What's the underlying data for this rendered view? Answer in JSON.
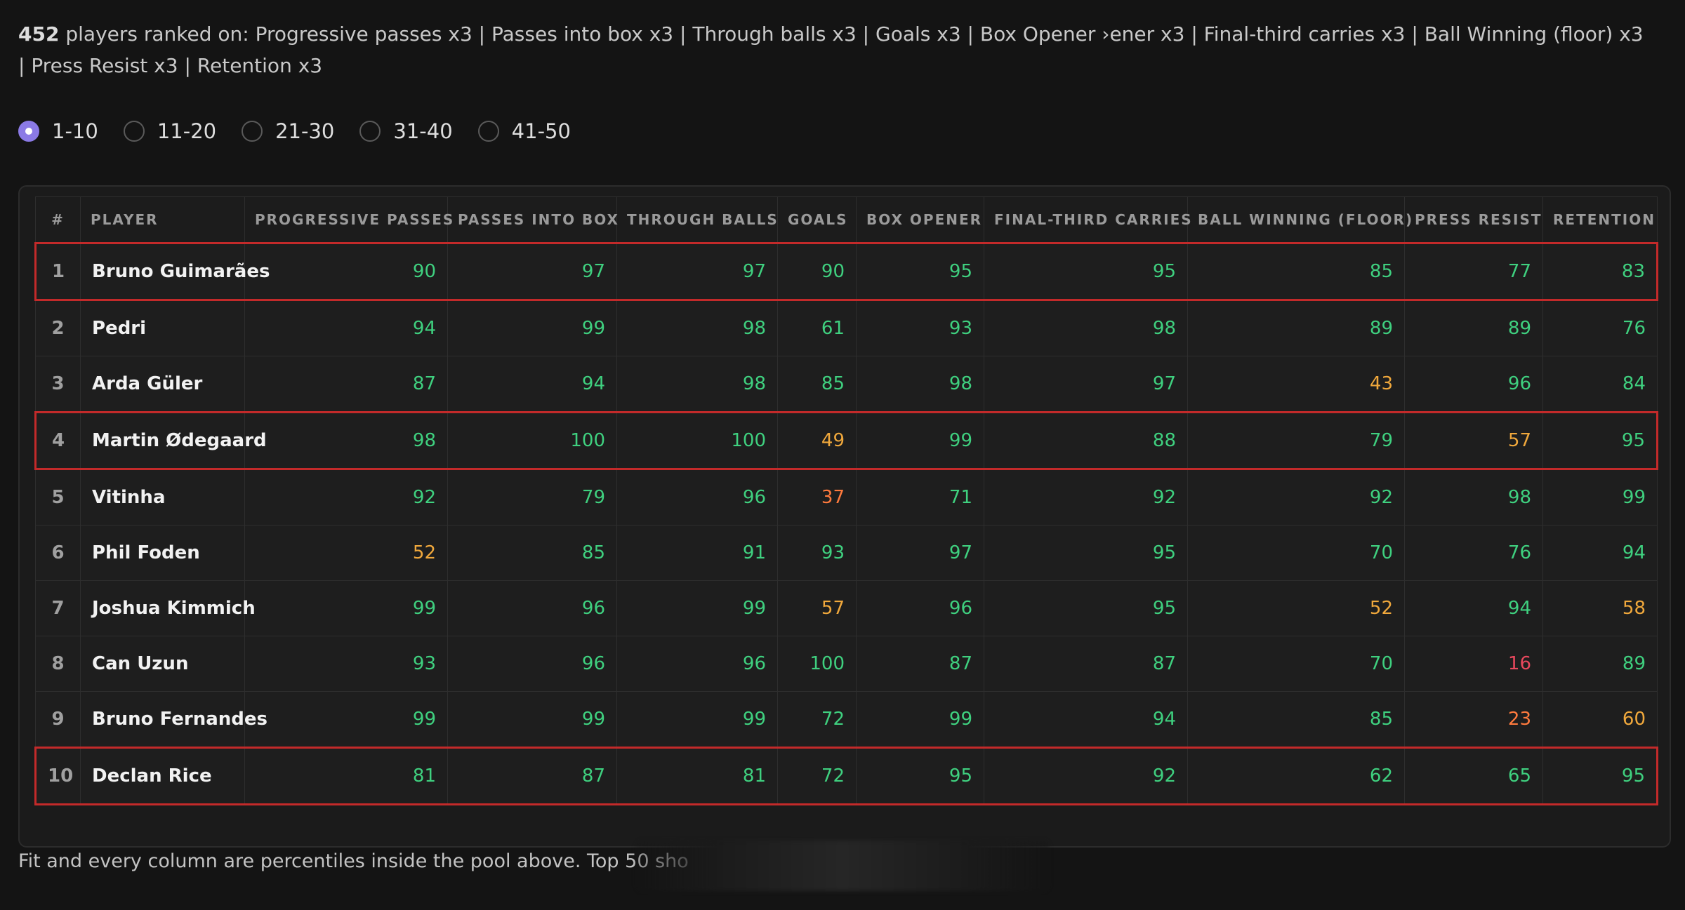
{
  "summary": {
    "count": "452",
    "text": " players ranked on: Progressive passes x3 | Passes into box x3 | Through balls x3 | Goals x3 | Box Opener ›ener x3 | Final-third carries x3 | Ball Winning (floor) x3 | Press Resist x3 | Retention x3"
  },
  "pages": [
    {
      "label": "1-10",
      "selected": true
    },
    {
      "label": "11-20",
      "selected": false
    },
    {
      "label": "21-30",
      "selected": false
    },
    {
      "label": "31-40",
      "selected": false
    },
    {
      "label": "41-50",
      "selected": false
    }
  ],
  "table": {
    "headers": [
      "#",
      "Player",
      "Progressive Passes",
      "Passes Into Box",
      "Through Balls",
      "Goals",
      "Box Opener",
      "Final-Third Carries",
      "Ball Winning (Floor)",
      "Press Resist",
      "Retention"
    ],
    "rows": [
      {
        "rank": "1",
        "player": "Bruno Guimarães",
        "highlighted": true,
        "values": [
          "90",
          "97",
          "97",
          "90",
          "95",
          "95",
          "85",
          "77",
          "83"
        ],
        "tones": [
          "green",
          "green",
          "green",
          "green",
          "green",
          "green",
          "green",
          "green",
          "green"
        ]
      },
      {
        "rank": "2",
        "player": "Pedri",
        "highlighted": false,
        "values": [
          "94",
          "99",
          "98",
          "61",
          "93",
          "98",
          "89",
          "89",
          "76"
        ],
        "tones": [
          "green",
          "green",
          "green",
          "green",
          "green",
          "green",
          "green",
          "green",
          "green"
        ]
      },
      {
        "rank": "3",
        "player": "Arda Güler",
        "highlighted": false,
        "values": [
          "87",
          "94",
          "98",
          "85",
          "98",
          "97",
          "43",
          "96",
          "84"
        ],
        "tones": [
          "green",
          "green",
          "green",
          "green",
          "green",
          "green",
          "amber",
          "green",
          "green"
        ]
      },
      {
        "rank": "4",
        "player": "Martin Ødegaard",
        "highlighted": true,
        "values": [
          "98",
          "100",
          "100",
          "49",
          "99",
          "88",
          "79",
          "57",
          "95"
        ],
        "tones": [
          "green",
          "green",
          "green",
          "amber",
          "green",
          "green",
          "green",
          "amber",
          "green"
        ]
      },
      {
        "rank": "5",
        "player": "Vitinha",
        "highlighted": false,
        "values": [
          "92",
          "79",
          "96",
          "37",
          "71",
          "92",
          "92",
          "98",
          "99"
        ],
        "tones": [
          "green",
          "green",
          "green",
          "orange",
          "green",
          "green",
          "green",
          "green",
          "green"
        ]
      },
      {
        "rank": "6",
        "player": "Phil Foden",
        "highlighted": false,
        "values": [
          "52",
          "85",
          "91",
          "93",
          "97",
          "95",
          "70",
          "76",
          "94"
        ],
        "tones": [
          "amber",
          "green",
          "green",
          "green",
          "green",
          "green",
          "green",
          "green",
          "green"
        ]
      },
      {
        "rank": "7",
        "player": "Joshua Kimmich",
        "highlighted": false,
        "values": [
          "99",
          "96",
          "99",
          "57",
          "96",
          "95",
          "52",
          "94",
          "58"
        ],
        "tones": [
          "green",
          "green",
          "green",
          "amber",
          "green",
          "green",
          "amber",
          "green",
          "amber"
        ]
      },
      {
        "rank": "8",
        "player": "Can Uzun",
        "highlighted": false,
        "values": [
          "93",
          "96",
          "96",
          "100",
          "87",
          "87",
          "70",
          "16",
          "89"
        ],
        "tones": [
          "green",
          "green",
          "green",
          "green",
          "green",
          "green",
          "green",
          "red",
          "green"
        ]
      },
      {
        "rank": "9",
        "player": "Bruno Fernandes",
        "highlighted": false,
        "values": [
          "99",
          "99",
          "99",
          "72",
          "99",
          "94",
          "85",
          "23",
          "60"
        ],
        "tones": [
          "green",
          "green",
          "green",
          "green",
          "green",
          "green",
          "green",
          "orange",
          "amber"
        ]
      },
      {
        "rank": "10",
        "player": "Declan Rice",
        "highlighted": true,
        "values": [
          "81",
          "87",
          "81",
          "72",
          "95",
          "92",
          "62",
          "65",
          "95"
        ],
        "tones": [
          "green",
          "green",
          "green",
          "green",
          "green",
          "green",
          "green",
          "green",
          "green"
        ]
      }
    ]
  },
  "footer": "Fit and every column are percentiles inside the pool above. Top 50 sho",
  "colors": {
    "accent": "#8b7ae6",
    "highlight_border": "#c32a2a",
    "green": "#3fd07f",
    "amber": "#f0a83c",
    "orange": "#ff7a3d",
    "red": "#e8485d"
  }
}
